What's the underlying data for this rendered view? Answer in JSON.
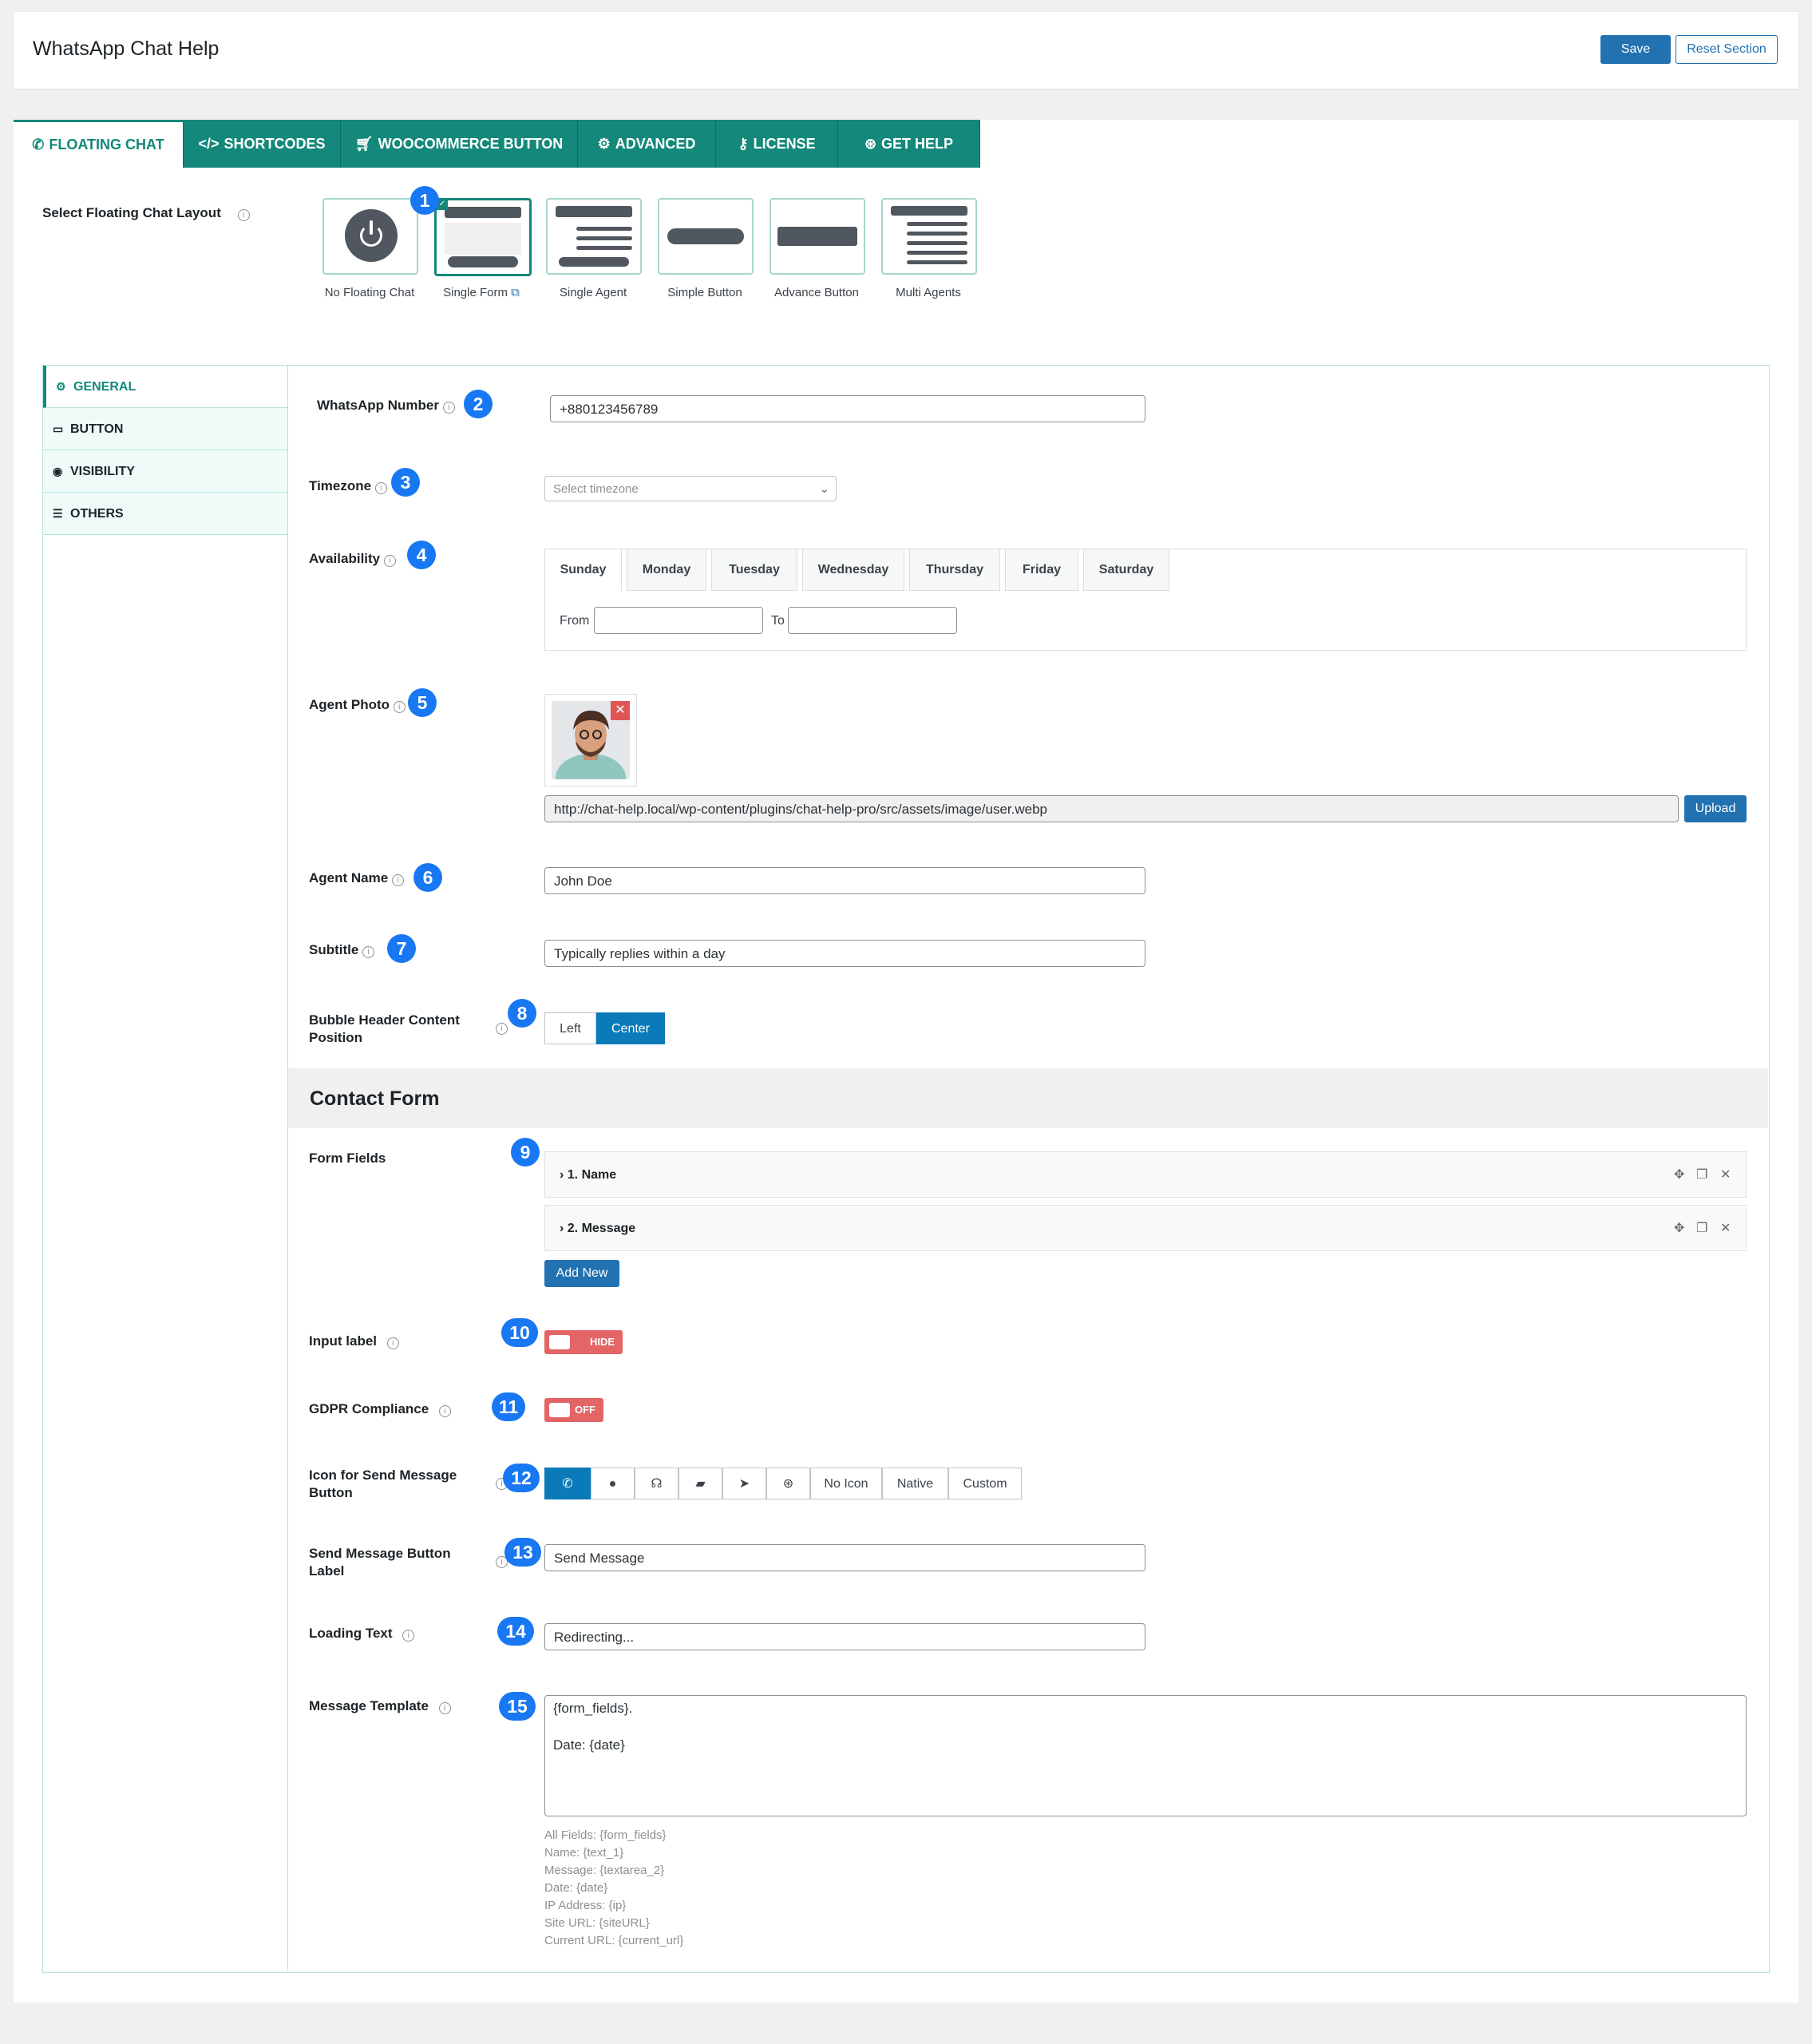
{
  "header": {
    "title": "WhatsApp Chat Help",
    "save": "Save",
    "reset": "Reset Section"
  },
  "tabs": [
    {
      "label": "FLOATING CHAT",
      "icon": "whatsapp-icon"
    },
    {
      "label": "SHORTCODES",
      "icon": "code-icon"
    },
    {
      "label": "WOOCOMMERCE BUTTON",
      "icon": "cart-icon"
    },
    {
      "label": "ADVANCED",
      "icon": "gears-icon"
    },
    {
      "label": "LICENSE",
      "icon": "key-icon"
    },
    {
      "label": "GET HELP",
      "icon": "lifebuoy-icon"
    }
  ],
  "layout": {
    "label": "Select Floating Chat Layout",
    "selected": "Single Form",
    "options": [
      "No Floating Chat",
      "Single Form",
      "Single Agent",
      "Simple Button",
      "Advance Button",
      "Multi Agents"
    ]
  },
  "sidenav": [
    "GENERAL",
    "BUTTON",
    "VISIBILITY",
    "OTHERS"
  ],
  "badges": [
    "1",
    "2",
    "3",
    "4",
    "5",
    "6",
    "7",
    "8",
    "9",
    "10",
    "11",
    "12",
    "13",
    "14",
    "15"
  ],
  "fields": {
    "whatsapp_label": "WhatsApp Number",
    "whatsapp_value": "+880123456789",
    "timezone_label": "Timezone",
    "timezone_placeholder": "Select timezone",
    "availability_label": "Availability",
    "days": [
      "Sunday",
      "Monday",
      "Tuesday",
      "Wednesday",
      "Thursday",
      "Friday",
      "Saturday"
    ],
    "from_label": "From",
    "to_label": "To",
    "photo_label": "Agent Photo",
    "photo_url": "http://chat-help.local/wp-content/plugins/chat-help-pro/src/assets/image/user.webp",
    "upload": "Upload",
    "agent_name_label": "Agent Name",
    "agent_name_value": "John Doe",
    "subtitle_label": "Subtitle",
    "subtitle_value": "Typically replies within a day",
    "bubble_label_1": "Bubble Header Content",
    "bubble_label_2": "Position",
    "bubble_options": [
      "Left",
      "Center"
    ],
    "bubble_selected": "Center"
  },
  "contact_form": {
    "heading": "Contact Form",
    "form_fields_label": "Form Fields",
    "items": [
      "1. Name",
      "2. Message"
    ],
    "add_new": "Add New",
    "input_label_label": "Input label",
    "input_label_state": "HIDE",
    "gdpr_label": "GDPR Compliance",
    "gdpr_state": "OFF",
    "icon_label_1": "Icon for Send Message",
    "icon_label_2": "Button",
    "icon_text_options": [
      "No Icon",
      "Native",
      "Custom"
    ],
    "send_label_1": "Send Message Button",
    "send_label_2": "Label",
    "send_value": "Send Message",
    "loading_label": "Loading Text",
    "loading_value": "Redirecting...",
    "template_label": "Message Template",
    "template_line1": "{form_fields}.",
    "template_line2": "Date: {date}",
    "hints": [
      "All Fields: {form_fields}",
      "Name: {text_1}",
      "Message: {textarea_2}",
      "Date: {date}",
      "IP Address: {ip}",
      "Site URL: {siteURL}",
      "Current URL: {current_url}"
    ]
  },
  "colors": {
    "accent": "#14887a",
    "wp_blue": "#2271b1",
    "badge": "#1877f2",
    "toggle_off": "#e36565"
  }
}
